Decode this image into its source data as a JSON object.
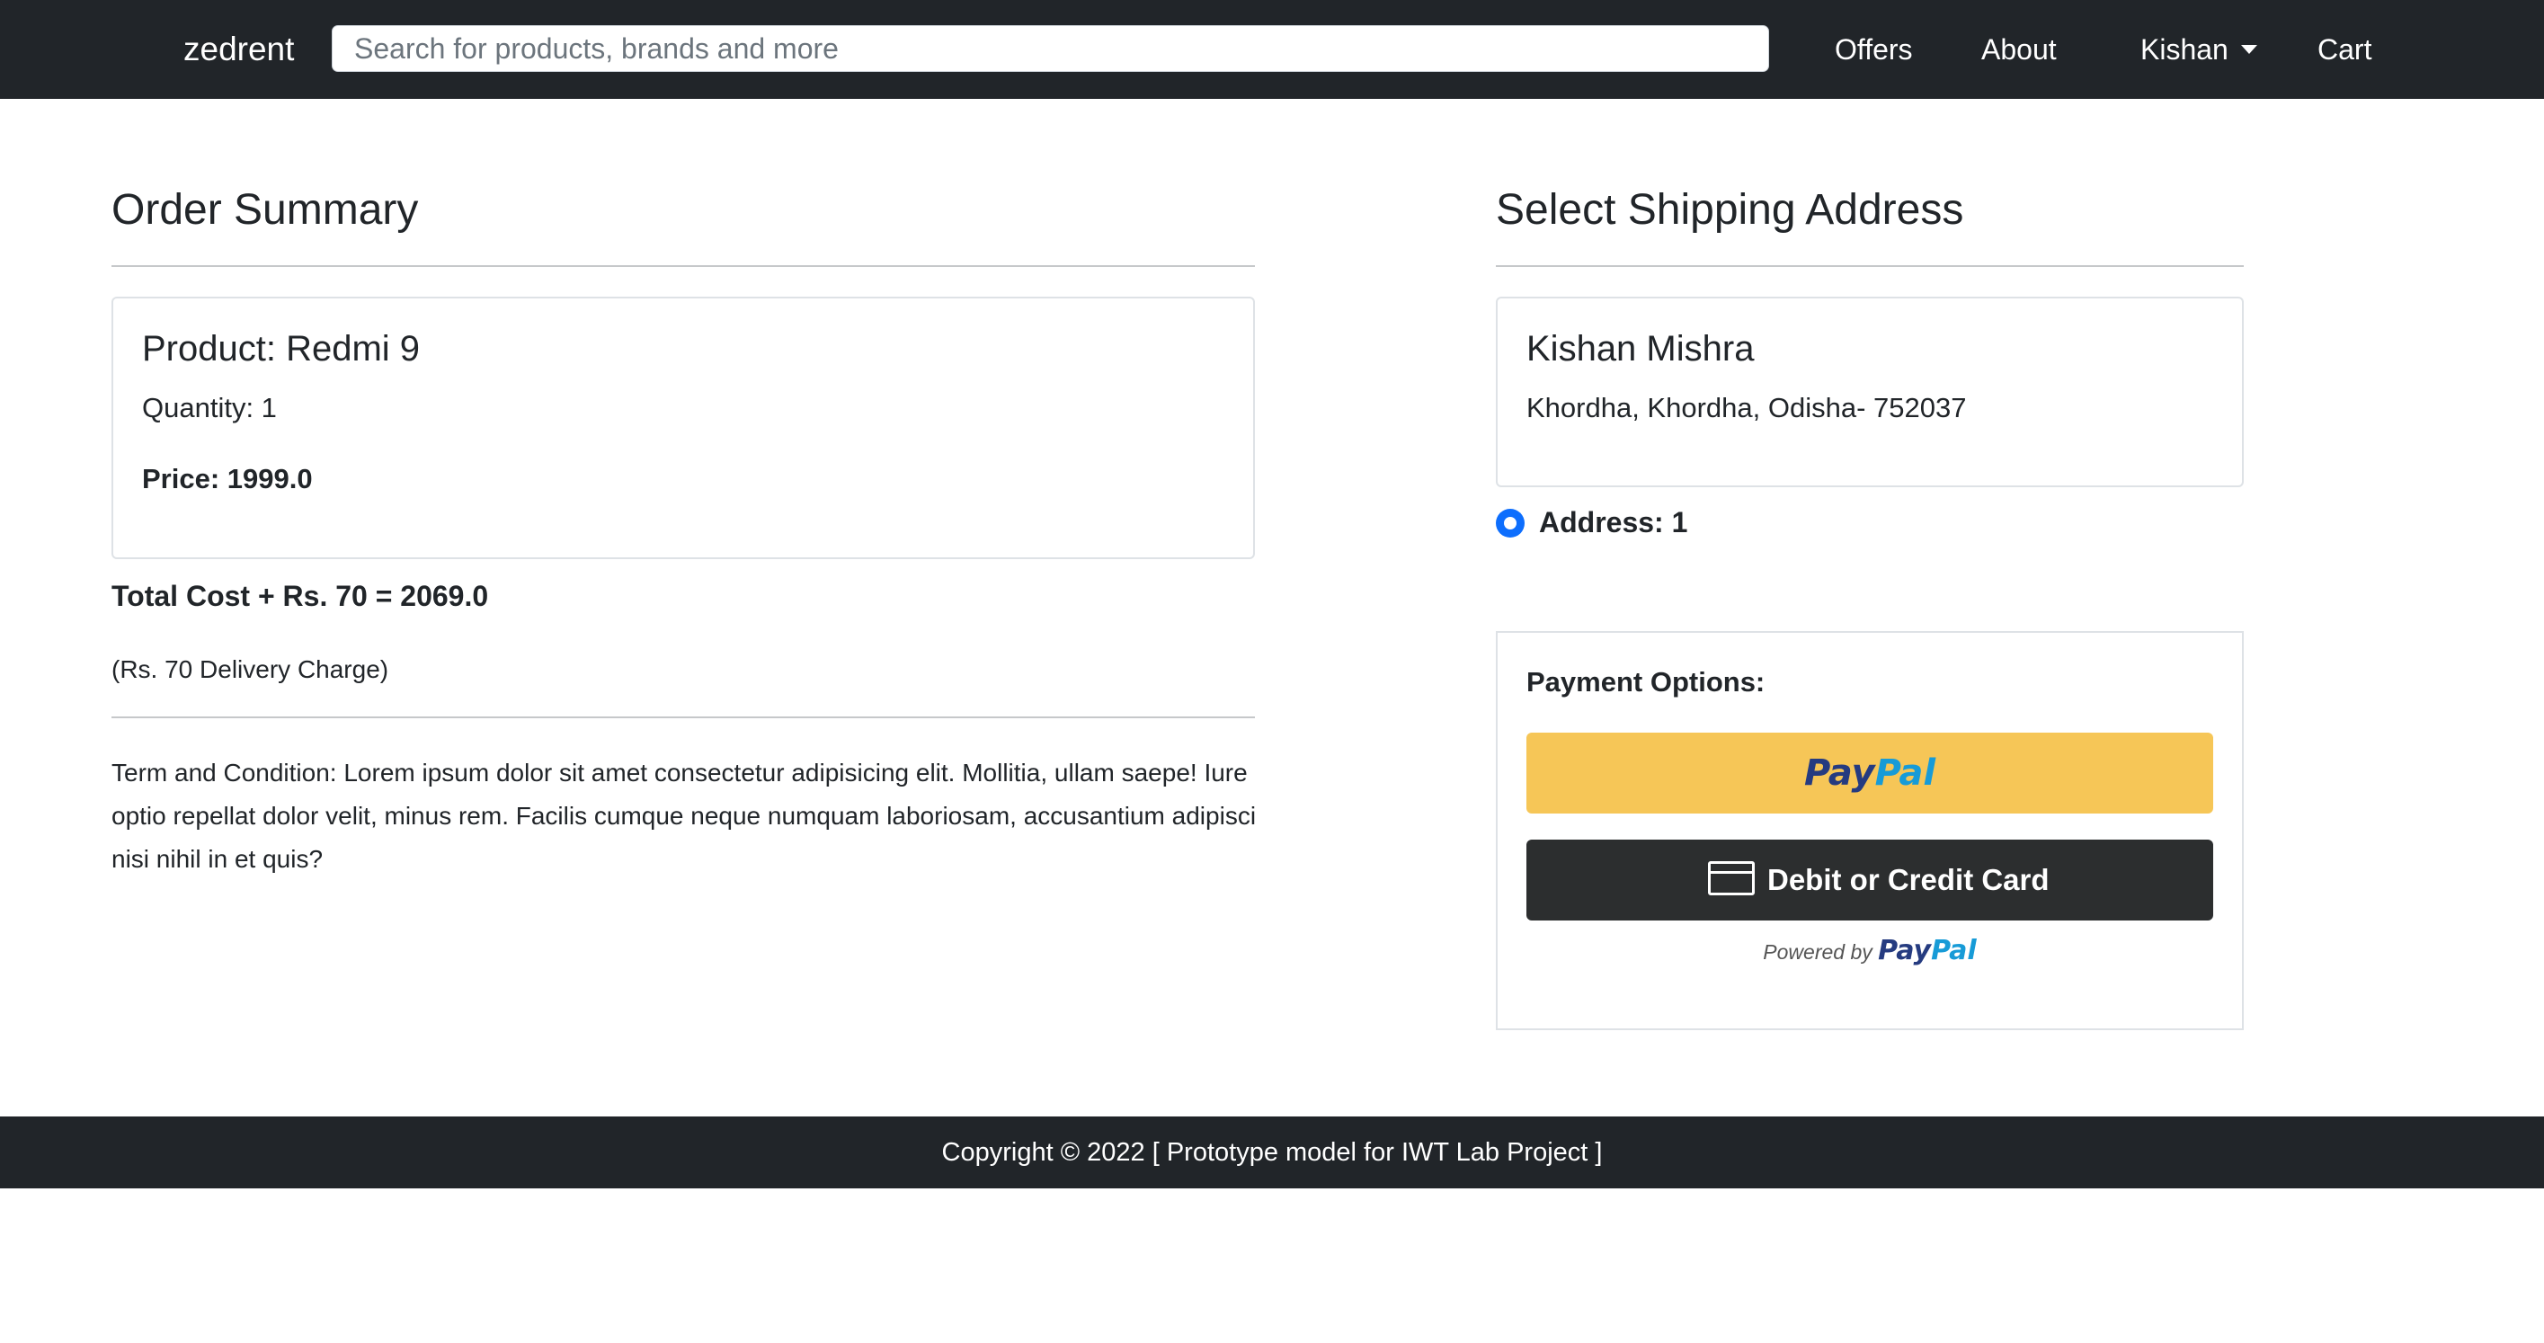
{
  "navbar": {
    "brand": "zedrent",
    "search_placeholder": "Search for products, brands and more",
    "links": {
      "offers": "Offers",
      "about": "About",
      "user": "Kishan",
      "cart": "Cart"
    }
  },
  "order_summary": {
    "title": "Order Summary",
    "product": "Product: Redmi 9",
    "quantity": "Quantity: 1",
    "price": "Price: 1999.0",
    "total": "Total Cost + Rs. 70 = 2069.0",
    "delivery_note": "(Rs. 70 Delivery Charge)",
    "terms": "Term and Condition: Lorem ipsum dolor sit amet consectetur adipisicing elit. Mollitia, ullam saepe! Iure optio repellat dolor velit, minus rem. Facilis cumque neque numquam laboriosam, accusantium adipisci nisi nihil in et quis?"
  },
  "shipping": {
    "title": "Select Shipping Address",
    "name": "Kishan Mishra",
    "address": "Khordha, Khordha, Odisha- 752037",
    "radio_label": "Address: 1"
  },
  "payment": {
    "title": "Payment Options:",
    "paypal_part1": "Pay",
    "paypal_part2": "Pal",
    "card_button": "Debit or Credit Card",
    "powered_by": "Powered by",
    "powered_part1": "Pay",
    "powered_part2": "Pal"
  },
  "footer": {
    "text": "Copyright © 2022 [ Prototype model for IWT Lab Project ]"
  },
  "colors": {
    "navbar": "#212529",
    "paypal_yellow": "#f6c657",
    "card_button": "#2c2e2f",
    "radio_accent": "#0d6efd"
  }
}
